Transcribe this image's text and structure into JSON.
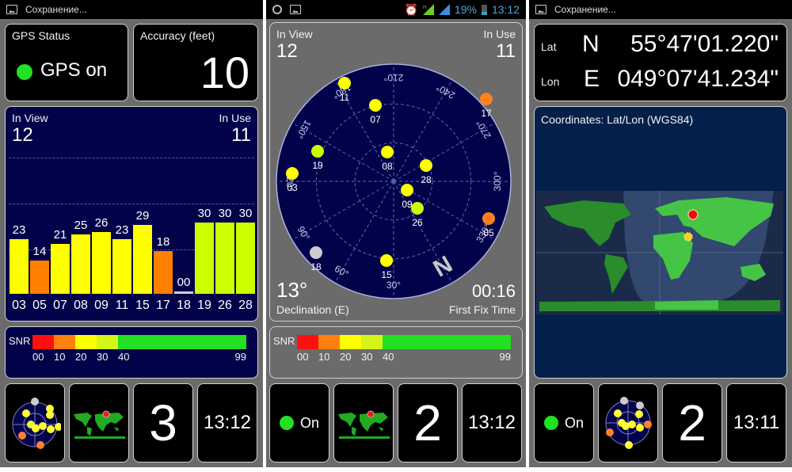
{
  "screens": [
    {
      "status_text": "Сохранение...",
      "gps_status": {
        "label": "GPS Status",
        "value": "GPS on",
        "indicator_color": "#22e022"
      },
      "accuracy": {
        "label": "Accuracy (feet)",
        "value": "10"
      },
      "signal": {
        "in_view_label": "In View",
        "in_view": "12",
        "in_use_label": "In Use",
        "in_use": "11",
        "satellites": [
          {
            "id": "03",
            "snr": 23,
            "color": "#ffff00"
          },
          {
            "id": "05",
            "snr": 14,
            "color": "#ff8000"
          },
          {
            "id": "07",
            "snr": 21,
            "color": "#ffff00"
          },
          {
            "id": "08",
            "snr": 25,
            "color": "#ffff00"
          },
          {
            "id": "09",
            "snr": 26,
            "color": "#ffff00"
          },
          {
            "id": "11",
            "snr": 23,
            "color": "#ffff00"
          },
          {
            "id": "15",
            "snr": 29,
            "color": "#ffff00"
          },
          {
            "id": "17",
            "snr": 18,
            "color": "#ff8000"
          },
          {
            "id": "18",
            "snr": 0,
            "label": "00",
            "color": "#cfcfcf"
          },
          {
            "id": "19",
            "snr": 30,
            "color": "#ccff00"
          },
          {
            "id": "26",
            "snr": 30,
            "color": "#ccff00"
          },
          {
            "id": "28",
            "snr": 30,
            "color": "#ccff00"
          }
        ]
      },
      "snr_legend": {
        "label": "SNR",
        "ticks": [
          "00",
          "10",
          "20",
          "30",
          "40",
          "99"
        ]
      },
      "tiles": {
        "number": "3",
        "time": "13:12"
      }
    },
    {
      "status_time": "13:12",
      "battery": "19%",
      "skyplot": {
        "in_view_label": "In View",
        "in_view": "12",
        "in_use_label": "In Use",
        "in_use": "11",
        "declination": "13°",
        "declination_label": "Declination (E)",
        "fix_time": "00:16",
        "fix_time_label": "First Fix Time",
        "north_label": "N",
        "bearings": [
          "30°",
          "60°",
          "90°",
          "120°",
          "150°",
          "180°",
          "210°",
          "240°",
          "270°",
          "300°",
          "330°"
        ],
        "satellites": [
          {
            "id": "11",
            "color": "#ffff00"
          },
          {
            "id": "07",
            "color": "#ffff00"
          },
          {
            "id": "17",
            "color": "#ff8020"
          },
          {
            "id": "19",
            "color": "#ccff00"
          },
          {
            "id": "03",
            "color": "#ffff00"
          },
          {
            "id": "08",
            "color": "#ffff00"
          },
          {
            "id": "28",
            "color": "#ffff00"
          },
          {
            "id": "09",
            "color": "#ffff00"
          },
          {
            "id": "26",
            "color": "#ccff00"
          },
          {
            "id": "05",
            "color": "#ff8020"
          },
          {
            "id": "18",
            "color": "#cccccc"
          },
          {
            "id": "15",
            "color": "#ffff00"
          }
        ]
      },
      "snr_legend": {
        "label": "SNR",
        "ticks": [
          "00",
          "10",
          "20",
          "30",
          "40",
          "99"
        ]
      },
      "tiles": {
        "status": "On",
        "number": "2",
        "time": "13:12"
      }
    },
    {
      "status_text": "Сохранение...",
      "coords": {
        "lat_label": "Lat",
        "lat_hemi": "N",
        "lat_value": "55°47'01.220\"",
        "lon_label": "Lon",
        "lon_hemi": "E",
        "lon_value": "049°07'41.234\""
      },
      "map": {
        "title": "Coordinates: Lat/Lon (WGS84)"
      },
      "tiles": {
        "status": "On",
        "number": "2",
        "time": "13:11"
      }
    }
  ]
}
